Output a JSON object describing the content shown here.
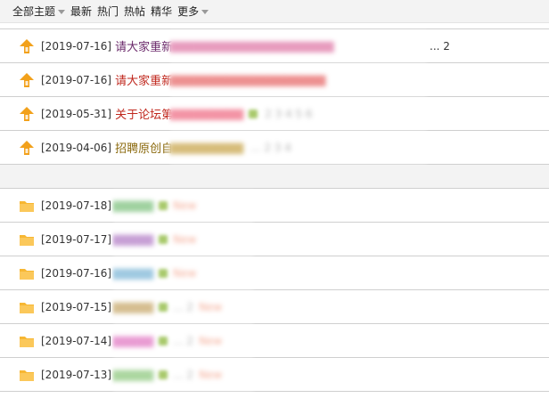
{
  "filters": [
    {
      "label": "全部主题",
      "caret": true
    },
    {
      "label": "最新",
      "caret": false
    },
    {
      "label": "热门",
      "caret": false
    },
    {
      "label": "热帖",
      "caret": false
    },
    {
      "label": "精华",
      "caret": false
    },
    {
      "label": "更多",
      "caret": true
    }
  ],
  "pinned": [
    {
      "date": "[2019-07-16]",
      "title": "请大家重新",
      "color": "#6b2a6b",
      "tail": "... 2"
    },
    {
      "date": "[2019-07-16]",
      "title": "请大家重新",
      "color": "#c0281e",
      "tail": ""
    },
    {
      "date": "[2019-05-31]",
      "title": "关于论坛第",
      "color": "#c0281e",
      "tail": ""
    },
    {
      "date": "[2019-04-06]",
      "title": "招聘原创自",
      "color": "#8c6b10",
      "tail": ""
    }
  ],
  "threads": [
    {
      "date": "[2019-07-18]",
      "title": "9",
      "color": "#3a9a3a"
    },
    {
      "date": "[2019-07-17]",
      "title": "9",
      "color": "#3a9a3a"
    },
    {
      "date": "[2019-07-16]",
      "title": "9",
      "color": "#3a9a3a"
    },
    {
      "date": "[2019-07-15]",
      "title": "9",
      "color": "#3a9a3a"
    },
    {
      "date": "[2019-07-14]",
      "title": "9",
      "color": "#3a9a3a"
    },
    {
      "date": "[2019-07-13]",
      "title": "9",
      "color": "#3a9a3a"
    }
  ]
}
